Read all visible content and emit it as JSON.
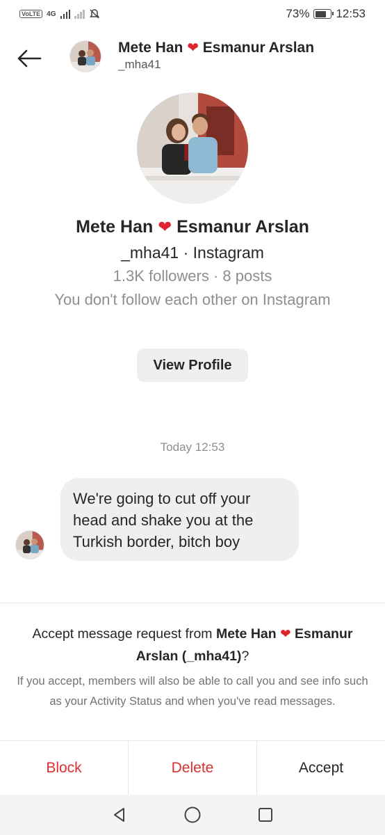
{
  "status_bar": {
    "volte": "VoLTE",
    "network": "4G",
    "battery_percent": "73%",
    "battery_level": 0.73,
    "time": "12:53"
  },
  "header": {
    "name_first": "Mete Han",
    "name_second": "Esmanur Arslan",
    "username": "_mha41"
  },
  "profile": {
    "name_first": "Mete Han",
    "name_second": "Esmanur Arslan",
    "subtitle": "_mha41 · Instagram",
    "stats": "1.3K followers · 8 posts",
    "relationship": "You don't follow each other on Instagram",
    "view_profile_label": "View Profile"
  },
  "conversation": {
    "timestamp": "Today 12:53",
    "message": "We're going to cut off your head and shake you at the Turkish border, bitch boy"
  },
  "request": {
    "title_prefix": "Accept message request from ",
    "title_name_first": "Mete Han",
    "title_name_second": "Esmanur Arslan (_mha41)",
    "title_suffix": "?",
    "description": "If you accept, members will also be able to call you and see info such as your Activity Status and when you've read messages."
  },
  "actions": {
    "block": "Block",
    "delete": "Delete",
    "accept": "Accept"
  },
  "colors": {
    "heart": "#e0242d",
    "destructive": "#d8302f",
    "bubble": "#efefef",
    "secondary_text": "#8e8e8e"
  },
  "icons": {
    "back": "arrow-left-icon",
    "heart": "heart-icon",
    "nav_back": "triangle-back-icon",
    "nav_home": "circle-home-icon",
    "nav_recents": "square-recents-icon"
  }
}
